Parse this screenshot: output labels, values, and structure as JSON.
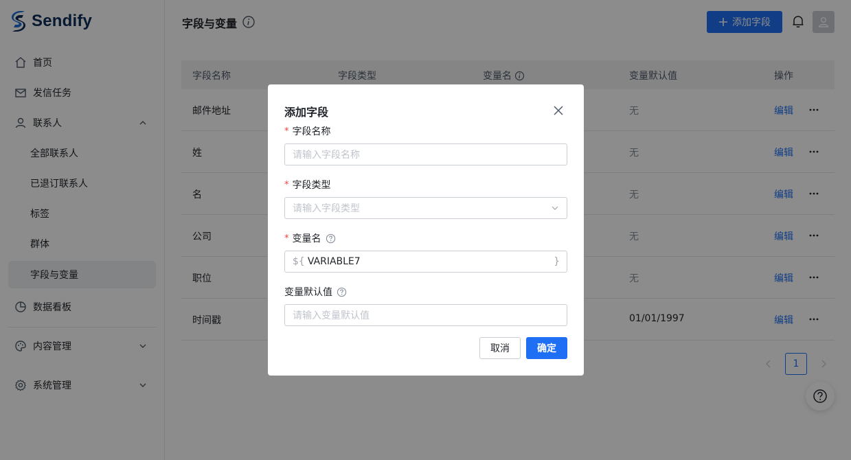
{
  "app": {
    "name": "Sendify"
  },
  "sidebar": {
    "items": [
      {
        "label": "首页",
        "icon": "home-icon"
      },
      {
        "label": "发信任务",
        "icon": "mail-icon"
      },
      {
        "label": "联系人",
        "icon": "user-icon",
        "expanded": true
      },
      {
        "label": "全部联系人"
      },
      {
        "label": "已退订联系人"
      },
      {
        "label": "标签"
      },
      {
        "label": "群体"
      },
      {
        "label": "字段与变量",
        "active": true
      },
      {
        "label": "数据看板",
        "icon": "pie-chart-icon"
      },
      {
        "label": "内容管理",
        "icon": "palette-icon"
      },
      {
        "label": "系统管理",
        "icon": "gear-icon"
      }
    ]
  },
  "header": {
    "title": "字段与变量",
    "add_button": "添加字段"
  },
  "table": {
    "headers": [
      "字段名称",
      "字段类型",
      "变量名",
      "变量默认值",
      "操作"
    ],
    "rows": [
      {
        "name": "邮件地址",
        "default": "无",
        "action": "编辑"
      },
      {
        "name": "姓",
        "default": "无",
        "action": "编辑"
      },
      {
        "name": "名",
        "default": "无",
        "action": "编辑"
      },
      {
        "name": "公司",
        "default": "无",
        "action": "编辑"
      },
      {
        "name": "职位",
        "default": "无",
        "action": "编辑"
      },
      {
        "name": "时间戳",
        "default": "01/01/1997",
        "action": "编辑"
      }
    ]
  },
  "pagination": {
    "current": "1"
  },
  "modal": {
    "title": "添加字段",
    "field_name": {
      "label": "字段名称",
      "placeholder": "请输入字段名称"
    },
    "field_type": {
      "label": "字段类型",
      "placeholder": "请输入字段类型"
    },
    "var_name": {
      "label": "变量名",
      "prefix": "${",
      "value": "VARIABLE7",
      "suffix": "}"
    },
    "var_default": {
      "label": "变量默认值",
      "placeholder": "请输入变量默认值"
    },
    "cancel": "取消",
    "ok": "确定"
  },
  "colors": {
    "primary": "#1e6ff3",
    "required": "#f53f3f"
  }
}
